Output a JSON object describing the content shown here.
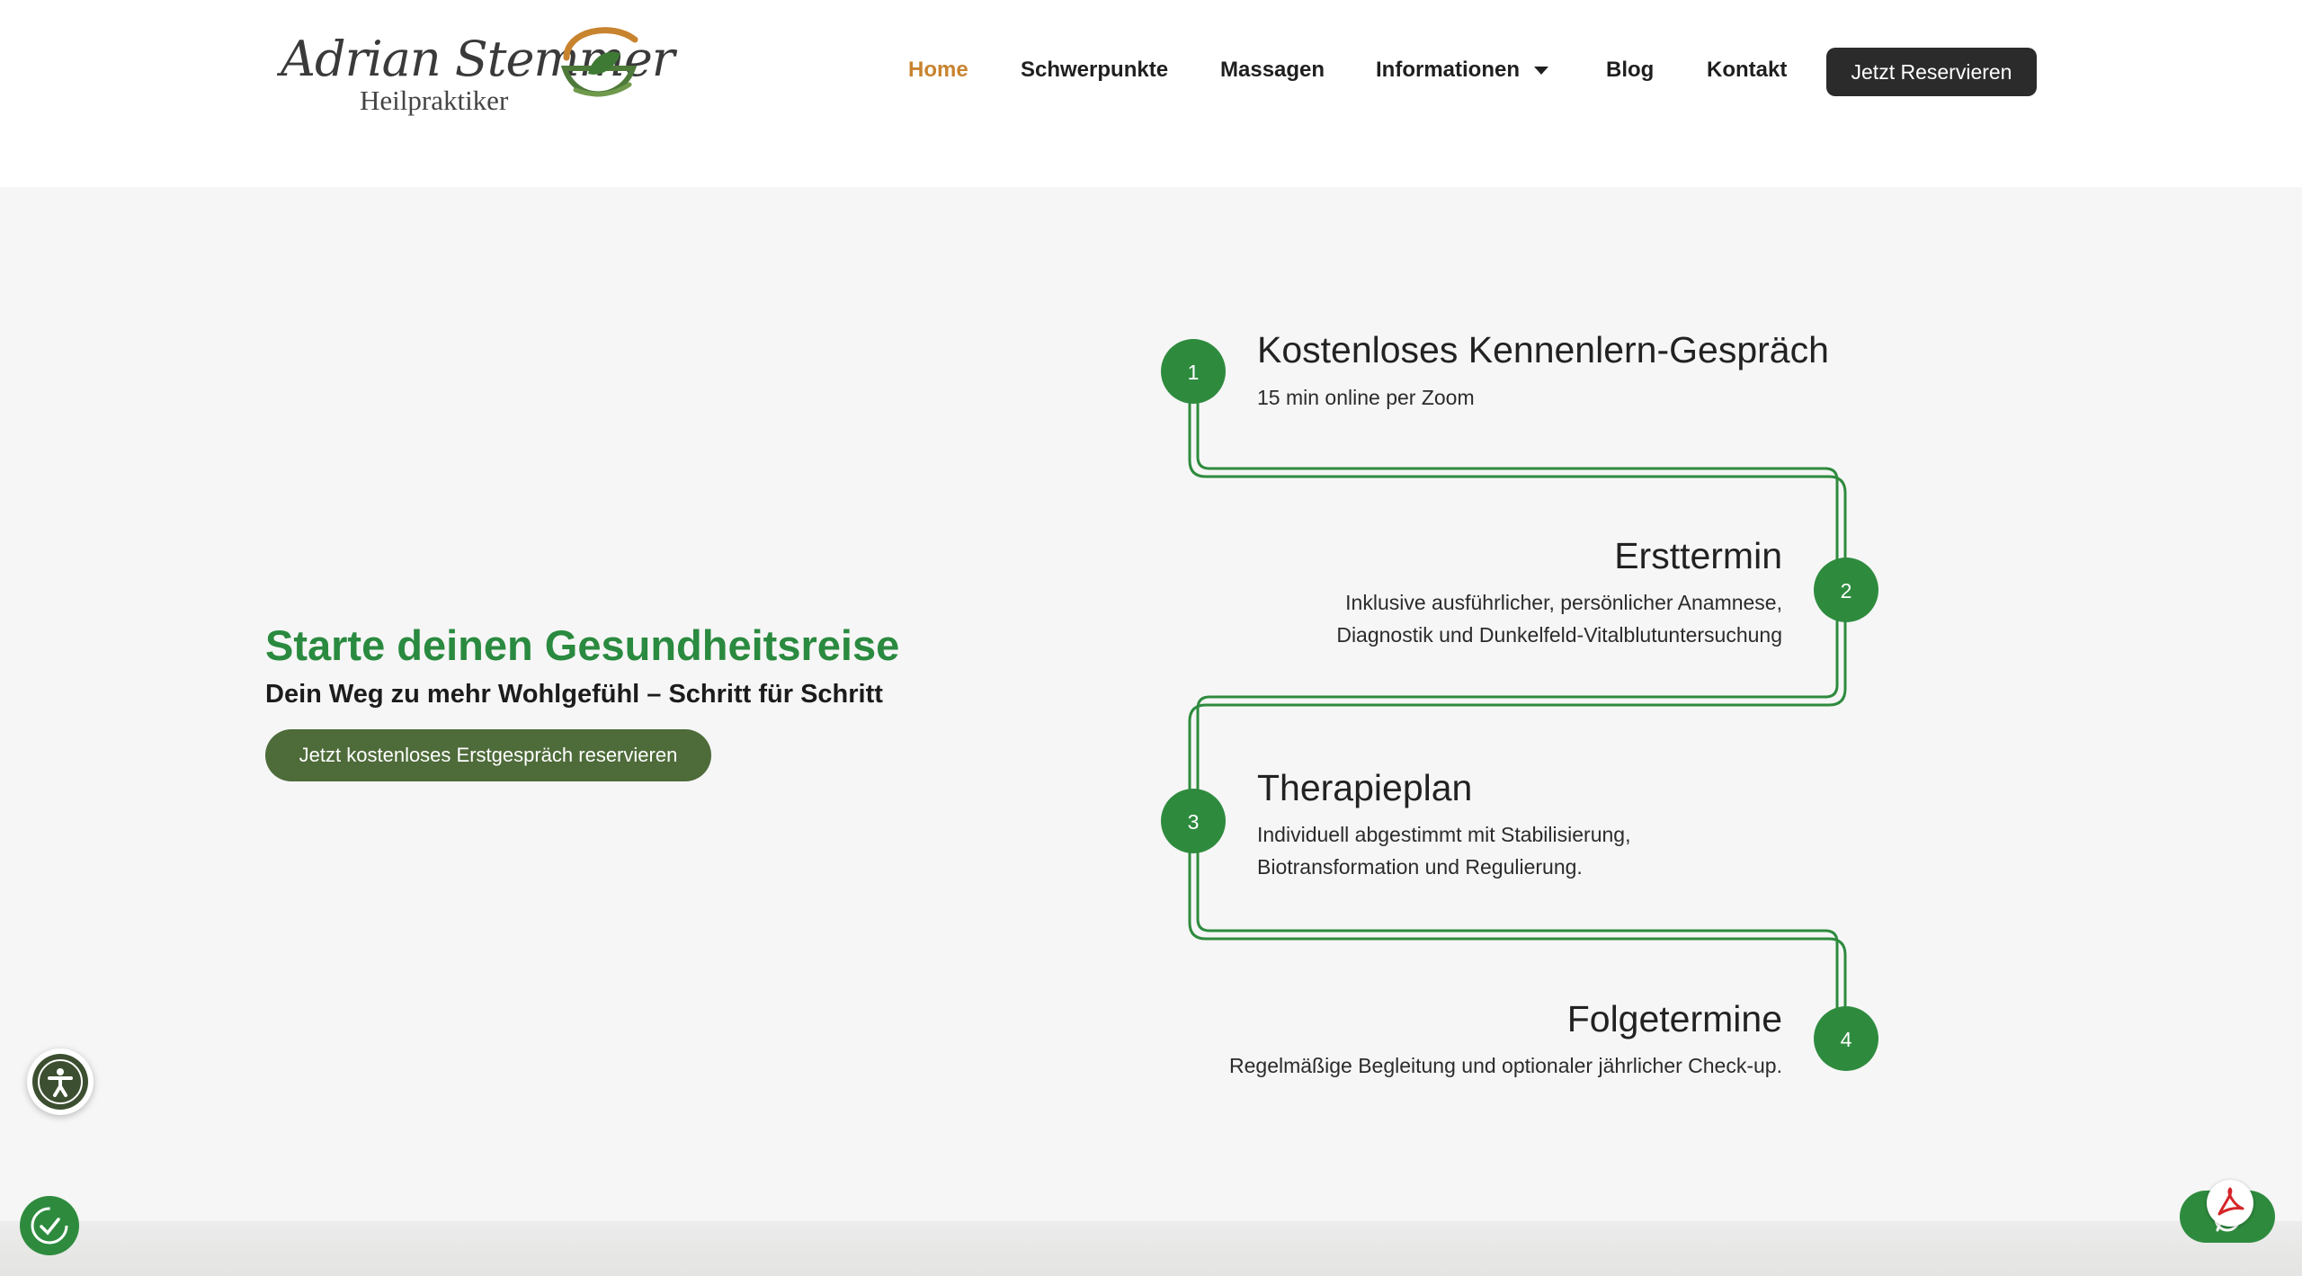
{
  "logo": {
    "script": "Adrian Stemmer",
    "sub": "Heilpraktiker"
  },
  "nav": {
    "items": [
      {
        "label": "Home",
        "active": true
      },
      {
        "label": "Schwerpunkte"
      },
      {
        "label": "Massagen"
      },
      {
        "label": "Informationen",
        "has_dropdown": true
      },
      {
        "label": "Blog"
      },
      {
        "label": "Kontakt"
      }
    ],
    "cta": "Jetzt Reservieren"
  },
  "hero": {
    "title": "Starte deinen Gesundheitsreise",
    "subtitle": "Dein Weg zu mehr Wohlgefühl – Schritt für Schritt",
    "cta": "Jetzt kostenloses Erstgespräch reservieren"
  },
  "steps": [
    {
      "number": "1",
      "title": "Kostenloses Kennenlern-Gespräch",
      "desc": [
        "15 min online per Zoom"
      ]
    },
    {
      "number": "2",
      "title": "Ersttermin",
      "desc": [
        "Inklusive ausführlicher, persönlicher Anamnese,",
        "Diagnostik und Dunkelfeld-Vitalblutuntersuchung"
      ]
    },
    {
      "number": "3",
      "title": "Therapieplan",
      "desc": [
        "Individuell abgestimmt mit Stabilisierung,",
        "Biotransformation und Regulierung."
      ]
    },
    {
      "number": "4",
      "title": "Folgetermine",
      "desc": [
        "Regelmäßige Begleitung und optionaler jährlicher Check-up."
      ]
    }
  ],
  "colors": {
    "brand_green": "#2e8b3e",
    "accent_orange": "#c8832f",
    "dark": "#2b2b2b",
    "cta_green": "#4e6b3a"
  },
  "icons": {
    "accessibility": "accessibility-icon",
    "consent": "cookie-consent-icon",
    "whatsapp": "whatsapp-icon",
    "pdf": "pdf-icon"
  }
}
